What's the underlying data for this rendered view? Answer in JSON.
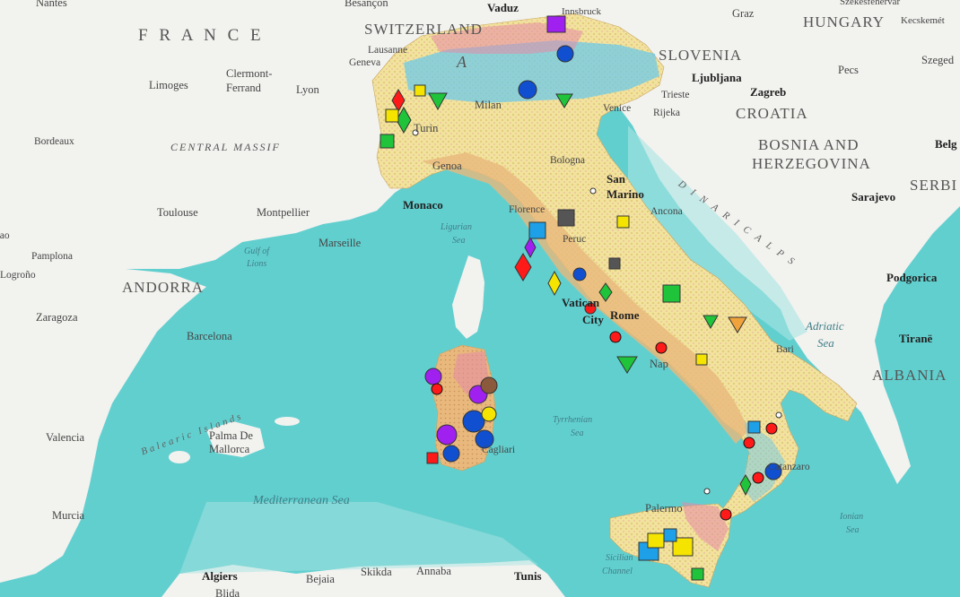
{
  "map": {
    "colors": {
      "sea_deep": "#62cfcf",
      "sea_shallow": "#a8e4e2",
      "land": "#f2f2ef",
      "italy_base": "#f1e39c",
      "geology_tan": "#e8b87c",
      "geology_blue": "#6ec9e8",
      "geology_pink": "#e58aa6"
    },
    "countries": [
      {
        "id": "france",
        "text": "F R A N C E"
      },
      {
        "id": "switzerland",
        "text": "SWITZERLAND"
      },
      {
        "id": "hungary",
        "text": "HUNGARY"
      },
      {
        "id": "slovenia",
        "text": "SLOVENIA"
      },
      {
        "id": "croatia",
        "text": "CROATIA"
      },
      {
        "id": "bosnia-1",
        "text": "BOSNIA AND"
      },
      {
        "id": "bosnia-2",
        "text": "HERZEGOVINA"
      },
      {
        "id": "andorra",
        "text": "ANDORRA"
      },
      {
        "id": "albania",
        "text": "ALBANIA"
      },
      {
        "id": "serbia",
        "text": "SERBI"
      }
    ],
    "cities": [
      {
        "id": "nantes",
        "text": "Nantes"
      },
      {
        "id": "besancon",
        "text": "Besançon"
      },
      {
        "id": "vaduz",
        "text": "Vaduz"
      },
      {
        "id": "innsbruck",
        "text": "Innsbruck"
      },
      {
        "id": "graz",
        "text": "Graz"
      },
      {
        "id": "szekesfehervar",
        "text": "Székesfehérvár"
      },
      {
        "id": "kecskemet",
        "text": "Kecskemét"
      },
      {
        "id": "lausanne",
        "text": "Lausanne"
      },
      {
        "id": "geneva",
        "text": "Geneva"
      },
      {
        "id": "szeged",
        "text": "Szeged"
      },
      {
        "id": "clermont-1",
        "text": "Clermont-"
      },
      {
        "id": "clermont-2",
        "text": "Ferrand"
      },
      {
        "id": "limoges",
        "text": "Limoges"
      },
      {
        "id": "lyon",
        "text": "Lyon"
      },
      {
        "id": "pecs",
        "text": "Pecs"
      },
      {
        "id": "ljubljana",
        "text": "Ljubljana"
      },
      {
        "id": "zagreb",
        "text": "Zagreb"
      },
      {
        "id": "milan",
        "text": "Milan"
      },
      {
        "id": "trieste",
        "text": "Trieste"
      },
      {
        "id": "rijeka",
        "text": "Rijeka"
      },
      {
        "id": "venice",
        "text": "Venice"
      },
      {
        "id": "bordeaux",
        "text": "Bordeaux"
      },
      {
        "id": "turin",
        "text": "Turin"
      },
      {
        "id": "belg",
        "text": "Belg"
      },
      {
        "id": "genoa",
        "text": "Genoa"
      },
      {
        "id": "bologna",
        "text": "Bologna"
      },
      {
        "id": "san-marino-1",
        "text": "San"
      },
      {
        "id": "san-marino-2",
        "text": "Marino"
      },
      {
        "id": "toulouse",
        "text": "Toulouse"
      },
      {
        "id": "montpellier",
        "text": "Montpellier"
      },
      {
        "id": "monaco",
        "text": "Monaco"
      },
      {
        "id": "florence",
        "text": "Florence"
      },
      {
        "id": "ancona",
        "text": "Ancona"
      },
      {
        "id": "sarajevo",
        "text": "Sarajevo"
      },
      {
        "id": "marseille",
        "text": "Marseille"
      },
      {
        "id": "bao",
        "text": "bao"
      },
      {
        "id": "pamplona",
        "text": "Pamplona"
      },
      {
        "id": "logrono",
        "text": "Logroño"
      },
      {
        "id": "perugia",
        "text": "Peruc"
      },
      {
        "id": "podgorica",
        "text": "Podgorica"
      },
      {
        "id": "zaragoza",
        "text": "Zaragoza"
      },
      {
        "id": "vatican-1",
        "text": "Vatican"
      },
      {
        "id": "vatican-2",
        "text": "City"
      },
      {
        "id": "rome",
        "text": "Rome"
      },
      {
        "id": "tirane",
        "text": "Tiranë"
      },
      {
        "id": "barcelona",
        "text": "Barcelona"
      },
      {
        "id": "bari",
        "text": "Bari"
      },
      {
        "id": "naples",
        "text": "Nap"
      },
      {
        "id": "valencia",
        "text": "Valencia"
      },
      {
        "id": "palma-1",
        "text": "Palma De"
      },
      {
        "id": "palma-2",
        "text": "Mallorca"
      },
      {
        "id": "cagliari",
        "text": "Cagliari"
      },
      {
        "id": "catanzaro",
        "text": "Catanzaro"
      },
      {
        "id": "palermo",
        "text": "Palermo"
      },
      {
        "id": "murcia",
        "text": "Murcia"
      },
      {
        "id": "algiers",
        "text": "Algiers"
      },
      {
        "id": "bejaia",
        "text": "Bejaia"
      },
      {
        "id": "skikda",
        "text": "Skikda"
      },
      {
        "id": "annaba",
        "text": "Annaba"
      },
      {
        "id": "tunis",
        "text": "Tunis"
      },
      {
        "id": "blida",
        "text": "Blida"
      }
    ],
    "seas": [
      {
        "id": "ligurian-1",
        "text": "Ligurian"
      },
      {
        "id": "ligurian-2",
        "text": "Sea"
      },
      {
        "id": "gulf-1",
        "text": "Gulf of"
      },
      {
        "id": "gulf-2",
        "text": "Lions"
      },
      {
        "id": "adriatic-1",
        "text": "Adriatic"
      },
      {
        "id": "adriatic-2",
        "text": "Sea"
      },
      {
        "id": "tyrrhenian-1",
        "text": "Tyrrhenian"
      },
      {
        "id": "tyrrhenian-2",
        "text": "Sea"
      },
      {
        "id": "mediterranean",
        "text": "Mediterranean Sea"
      },
      {
        "id": "ionian-1",
        "text": "Ionian"
      },
      {
        "id": "ionian-2",
        "text": "Sea"
      },
      {
        "id": "sicilian-1",
        "text": "Sicilian"
      },
      {
        "id": "sicilian-2",
        "text": "Channel"
      }
    ],
    "regions": [
      {
        "id": "central-massif",
        "text": "CENTRAL MASSIF"
      },
      {
        "id": "dinaric-alps",
        "text": "D I N A R I C   A L P S"
      },
      {
        "id": "balearic-islands",
        "text": "Balearic Islands"
      },
      {
        "id": "alps-a",
        "text": "A"
      }
    ]
  }
}
